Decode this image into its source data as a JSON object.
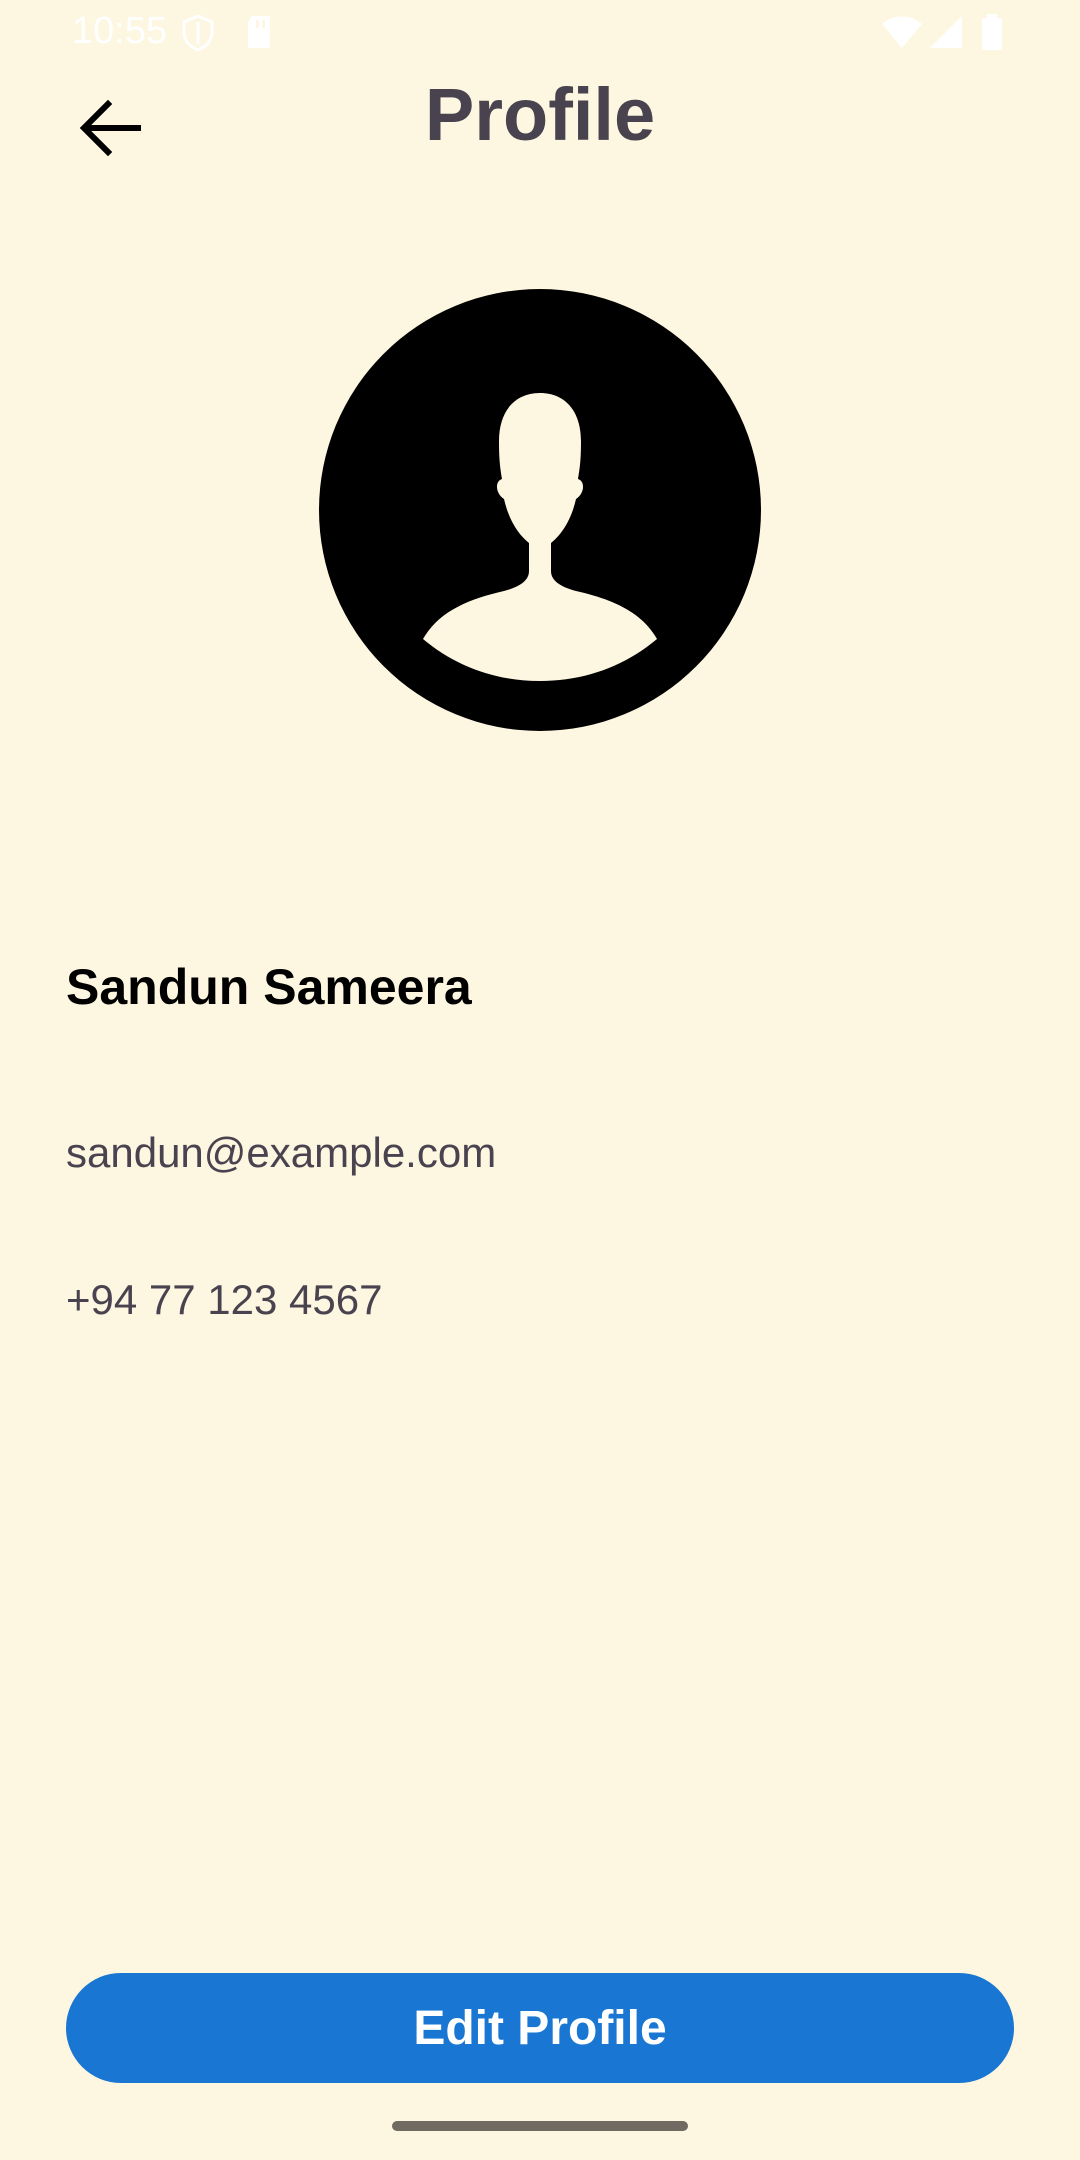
{
  "status_bar": {
    "time": "10:55"
  },
  "app_bar": {
    "title": "Profile",
    "back_icon": "arrow-left-icon"
  },
  "profile": {
    "avatar_icon": "user-avatar-icon",
    "name": "Sandun Sameera",
    "email": "sandun@example.com",
    "phone": "+94 77 123 4567"
  },
  "actions": {
    "edit_label": "Edit Profile"
  },
  "colors": {
    "background": "#FDF6E0",
    "primary": "#1976D2",
    "title_text": "#48434F"
  }
}
